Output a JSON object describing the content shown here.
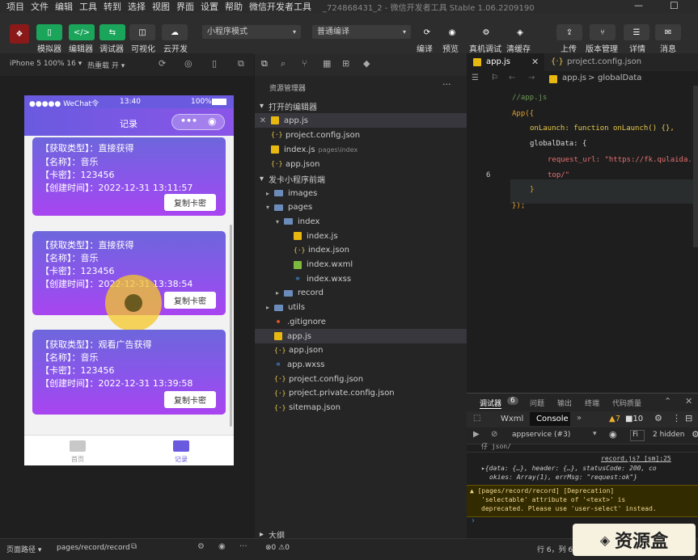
{
  "menu": {
    "items": [
      "项目",
      "文件",
      "编辑",
      "工具",
      "转到",
      "选择",
      "视图",
      "界面",
      "设置",
      "帮助",
      "微信开发者工具"
    ],
    "title": "_724868431_2 - 微信开发者工具 Stable 1.06.2209190"
  },
  "toolbar": {
    "buttons": [
      "模拟器",
      "编辑器",
      "调试器",
      "可视化",
      "云开发"
    ],
    "mode_select": "小程序模式",
    "compile_select": "普通编译",
    "actions": [
      "编译",
      "预览",
      "真机调试",
      "清缓存"
    ],
    "right_actions": [
      "上传",
      "版本管理",
      "详情",
      "消息"
    ]
  },
  "simulator": {
    "device": "iPhone 5 100% 16 ▾",
    "hotreload": "热重载 开 ▾",
    "statusbar": {
      "carrier": "●●●●● WeChat令",
      "time": "13:40",
      "battery": "100%"
    },
    "nav_title": "记录",
    "cards": [
      {
        "type": "【获取类型】：直接获得",
        "name": "【名称】：音乐",
        "code": "【卡密】：123456",
        "time": "【创建时间】：2022-12-31 13:11:57",
        "btn": "复制卡密"
      },
      {
        "type": "【获取类型】：直接获得",
        "name": "【名称】：音乐",
        "code": "【卡密】：123456",
        "time": "【创建时间】：2022-12-31 13:38:54",
        "btn": "复制卡密"
      },
      {
        "type": "【获取类型】：观看广告获得",
        "name": "【名称】：音乐",
        "code": "【卡密】：123456",
        "time": "【创建时间】：2022-12-31 13:39:58",
        "btn": "复制卡密"
      }
    ],
    "tabs": [
      "首页",
      "记录"
    ]
  },
  "explorer": {
    "header": "资源管理器",
    "open_editors_label": "打开的编辑器",
    "open_editors": [
      {
        "name": "app.js",
        "kind": "js"
      },
      {
        "name": "project.config.json",
        "kind": "json"
      },
      {
        "name": "index.js",
        "kind": "js",
        "hint": "pages\\index"
      },
      {
        "name": "app.json",
        "kind": "json"
      }
    ],
    "project_label": "发卡小程序前端",
    "tree": [
      {
        "name": "images",
        "kind": "folder",
        "indent": 1
      },
      {
        "name": "pages",
        "kind": "folder",
        "indent": 1
      },
      {
        "name": "index",
        "kind": "folder",
        "indent": 2
      },
      {
        "name": "index.js",
        "kind": "js",
        "indent": 3
      },
      {
        "name": "index.json",
        "kind": "json",
        "indent": 3
      },
      {
        "name": "index.wxml",
        "kind": "wxml",
        "indent": 3
      },
      {
        "name": "index.wxss",
        "kind": "css",
        "indent": 3
      },
      {
        "name": "record",
        "kind": "folder",
        "indent": 2
      },
      {
        "name": "utils",
        "kind": "folder",
        "indent": 1
      },
      {
        "name": ".gitignore",
        "kind": "git",
        "indent": 1
      },
      {
        "name": "app.js",
        "kind": "js",
        "indent": 1
      },
      {
        "name": "app.json",
        "kind": "json",
        "indent": 1
      },
      {
        "name": "app.wxss",
        "kind": "css",
        "indent": 1
      },
      {
        "name": "project.config.json",
        "kind": "json",
        "indent": 1
      },
      {
        "name": "project.private.config.json",
        "kind": "json",
        "indent": 1
      },
      {
        "name": "sitemap.json",
        "kind": "json",
        "indent": 1
      }
    ],
    "outline_label": "大纲",
    "problems": "⊗0 ⚠0"
  },
  "editor": {
    "tabs": [
      "app.js",
      "project.config.json"
    ],
    "breadcrumb_file": "app.js",
    "breadcrumb_sep": ">",
    "breadcrumb_symbol": "globalData",
    "line_numbers": [
      "",
      "",
      "",
      "",
      "",
      "6",
      "",
      ""
    ],
    "code": [
      {
        "text": "//app.js",
        "color": "#6a9955",
        "indent": 0
      },
      {
        "text": "App({",
        "color": "#e0a030",
        "indent": 0
      },
      {
        "text": "onLaunch: function onLaunch() {},",
        "color": "#e6c84a",
        "indent": 1
      },
      {
        "text": "globalData: {",
        "color": "#dcdcdc",
        "indent": 1
      },
      {
        "text": "request_url: \"https://fk.qulaida.",
        "color": "#e87070",
        "indent": 2
      },
      {
        "text": "top/\"",
        "color": "#e87070",
        "indent": 2
      },
      {
        "text": "}",
        "color": "#e0a030",
        "indent": 1
      },
      {
        "text": "});",
        "color": "#e0a030",
        "indent": 0
      }
    ]
  },
  "debugger": {
    "tabs": [
      "调试器",
      "6",
      "问题",
      "输出",
      "终端",
      "代码质量"
    ],
    "subtabs": [
      "Wxml",
      "Console",
      "»"
    ],
    "warn_count": "▲7",
    "err_count": "■10",
    "context": "appservice (#3)",
    "filter": "Fi",
    "hidden": "2 hidden",
    "logs": [
      {
        "text": "仔 json/",
        "color": "#aaa"
      },
      {
        "text": "record.js? [sm]:25",
        "color": "#ccc"
      },
      {
        "text": "▸{data: {…}, header: {…}, statusCode: 200, co",
        "color": "#ccc"
      },
      {
        "text": "okies: Array(1), errMsg: \"request:ok\"}",
        "color": "#ccc"
      },
      {
        "text": "▲ [pages/record/record] [Deprecation]",
        "color": "#f0d890"
      },
      {
        "text": "'selectable' attribute of '<text>' is",
        "color": "#f0d890"
      },
      {
        "text": "deprecated. Please use 'user-select' instead.",
        "color": "#f0d890"
      }
    ]
  },
  "footer": {
    "path_label": "页面路径 ▾",
    "path": "pages/record/record",
    "position": "行 6，列 6"
  },
  "watermark": "资源盒",
  "colors": {
    "accent": "#07c160",
    "card_top": "#6d66dc",
    "card_bottom": "#a944f0",
    "nav": "#6a5ae0"
  }
}
